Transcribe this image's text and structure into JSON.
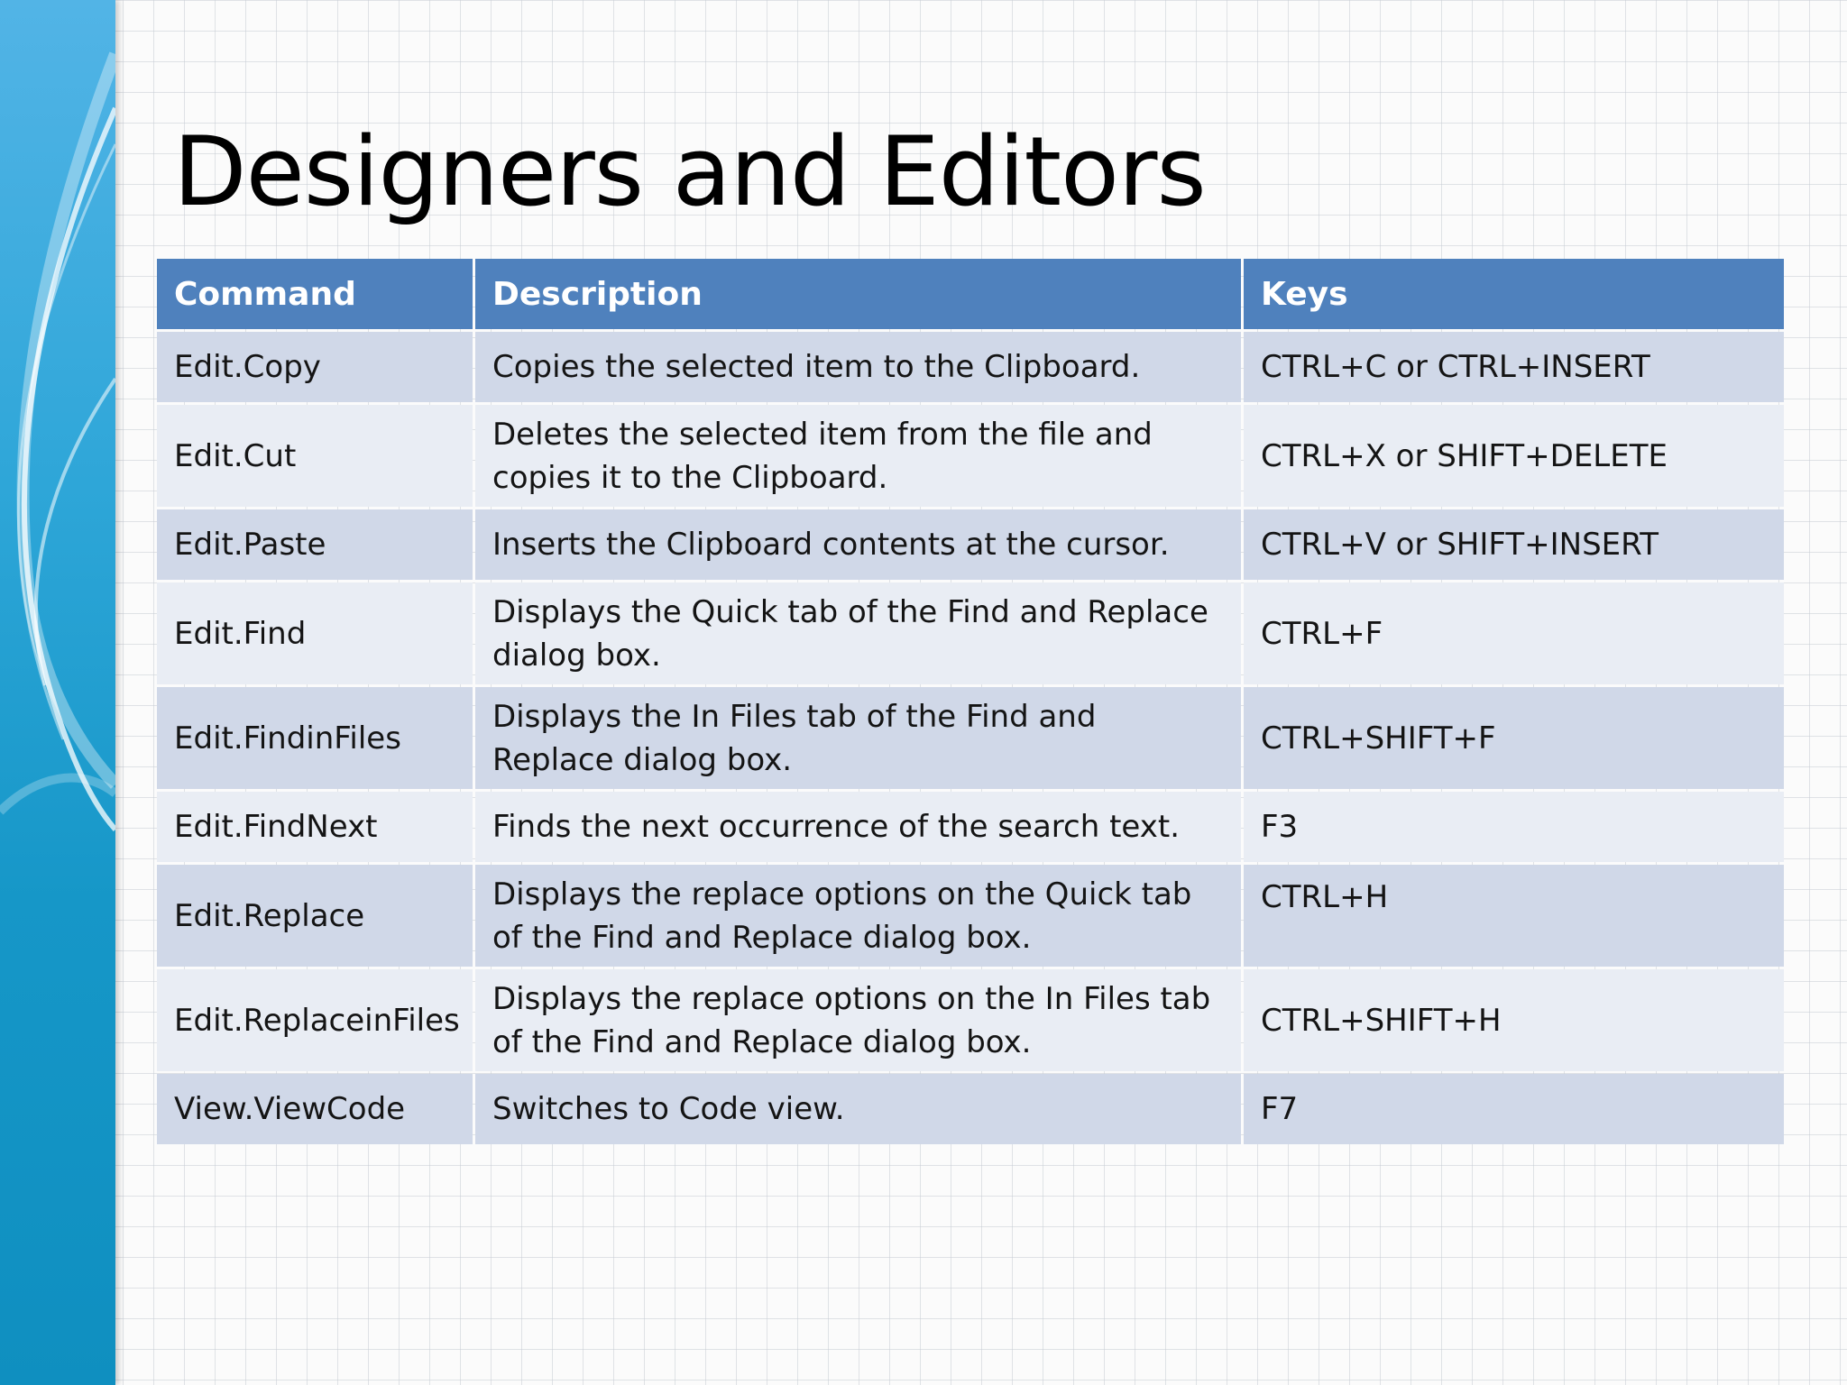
{
  "slide": {
    "title": "Designers and Editors"
  },
  "table": {
    "headers": {
      "command": "Command",
      "description": "Description",
      "keys": "Keys"
    },
    "rows": [
      {
        "command": "Edit.Copy",
        "description": "Copies the selected item to the Clipboard.",
        "keys": "CTRL+C or CTRL+INSERT"
      },
      {
        "command": "Edit.Cut",
        "description": "Deletes the selected item from the file and copies it to the Clipboard.",
        "keys": "CTRL+X or SHIFT+DELETE"
      },
      {
        "command": "Edit.Paste",
        "description": "Inserts the Clipboard contents at the cursor.",
        "keys": "CTRL+V or SHIFT+INSERT"
      },
      {
        "command": "Edit.Find",
        "description": "Displays the Quick tab of the Find and Replace dialog box.",
        "keys": "CTRL+F"
      },
      {
        "command": "Edit.FindinFiles",
        "description": "Displays the In Files tab of the Find and Replace dialog box.",
        "keys": "CTRL+SHIFT+F"
      },
      {
        "command": "Edit.FindNext",
        "description": "Finds the next occurrence of the search text.",
        "keys": "F3"
      },
      {
        "command": "Edit.Replace",
        "description": "Displays the replace options on the Quick tab of the Find and Replace dialog box.",
        "keys": "CTRL+H"
      },
      {
        "command": "Edit.ReplaceinFiles",
        "description": "Displays the replace options on the In Files tab of the Find and Replace dialog box.",
        "keys": "CTRL+SHIFT+H"
      },
      {
        "command": "View.ViewCode",
        "description": "Switches to Code view.",
        "keys": "F7"
      }
    ]
  },
  "colors": {
    "header_bg": "#4f81bd",
    "row_dark": "#d0d8e8",
    "row_light": "#e9edf4",
    "side_band": "#1e9fd2"
  }
}
